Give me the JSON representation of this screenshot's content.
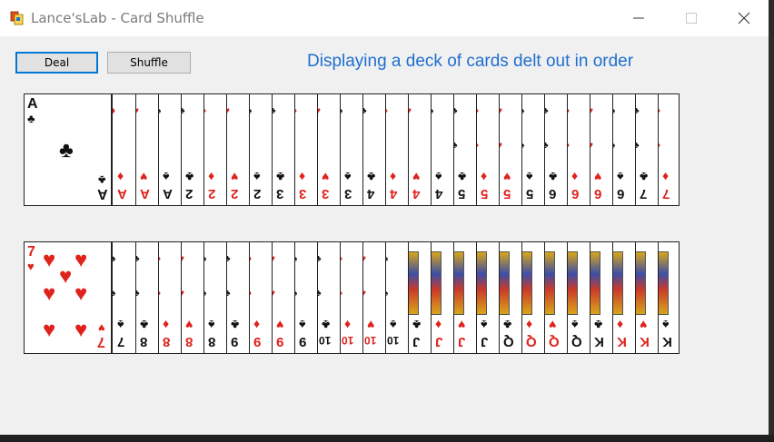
{
  "window": {
    "title": "Lance'sLab - Card Shuffle",
    "icons": {
      "app": "cards-app-icon",
      "minimize": "minimize-icon",
      "maximize": "maximize-icon",
      "close": "close-icon"
    }
  },
  "toolbar": {
    "deal_label": "Deal",
    "shuffle_label": "Shuffle"
  },
  "status_text": "Displaying a deck of cards delt out in order",
  "colors": {
    "red_suit": "#e0221c",
    "black_suit": "#111111",
    "accent": "#0078d7",
    "status_text": "#1f6fd0"
  },
  "rows": [
    {
      "cards": [
        {
          "rank": "A",
          "suit": "♣",
          "color": "black"
        },
        {
          "rank": "A",
          "suit": "♦",
          "color": "red"
        },
        {
          "rank": "A",
          "suit": "♥",
          "color": "red"
        },
        {
          "rank": "A",
          "suit": "♠",
          "color": "black"
        },
        {
          "rank": "2",
          "suit": "♣",
          "color": "black"
        },
        {
          "rank": "2",
          "suit": "♦",
          "color": "red"
        },
        {
          "rank": "2",
          "suit": "♥",
          "color": "red"
        },
        {
          "rank": "2",
          "suit": "♠",
          "color": "black"
        },
        {
          "rank": "3",
          "suit": "♣",
          "color": "black"
        },
        {
          "rank": "3",
          "suit": "♦",
          "color": "red"
        },
        {
          "rank": "3",
          "suit": "♥",
          "color": "red"
        },
        {
          "rank": "3",
          "suit": "♠",
          "color": "black"
        },
        {
          "rank": "4",
          "suit": "♣",
          "color": "black"
        },
        {
          "rank": "4",
          "suit": "♦",
          "color": "red"
        },
        {
          "rank": "4",
          "suit": "♥",
          "color": "red"
        },
        {
          "rank": "4",
          "suit": "♠",
          "color": "black"
        },
        {
          "rank": "5",
          "suit": "♣",
          "color": "black"
        },
        {
          "rank": "5",
          "suit": "♦",
          "color": "red"
        },
        {
          "rank": "5",
          "suit": "♥",
          "color": "red"
        },
        {
          "rank": "5",
          "suit": "♠",
          "color": "black"
        },
        {
          "rank": "6",
          "suit": "♣",
          "color": "black"
        },
        {
          "rank": "6",
          "suit": "♦",
          "color": "red"
        },
        {
          "rank": "6",
          "suit": "♥",
          "color": "red"
        },
        {
          "rank": "6",
          "suit": "♠",
          "color": "black"
        },
        {
          "rank": "7",
          "suit": "♣",
          "color": "black"
        },
        {
          "rank": "7",
          "suit": "♦",
          "color": "red"
        }
      ]
    },
    {
      "cards": [
        {
          "rank": "7",
          "suit": "♥",
          "color": "red"
        },
        {
          "rank": "7",
          "suit": "♠",
          "color": "black"
        },
        {
          "rank": "8",
          "suit": "♣",
          "color": "black"
        },
        {
          "rank": "8",
          "suit": "♦",
          "color": "red"
        },
        {
          "rank": "8",
          "suit": "♥",
          "color": "red"
        },
        {
          "rank": "8",
          "suit": "♠",
          "color": "black"
        },
        {
          "rank": "9",
          "suit": "♣",
          "color": "black"
        },
        {
          "rank": "9",
          "suit": "♦",
          "color": "red"
        },
        {
          "rank": "9",
          "suit": "♥",
          "color": "red"
        },
        {
          "rank": "9",
          "suit": "♠",
          "color": "black"
        },
        {
          "rank": "10",
          "suit": "♣",
          "color": "black"
        },
        {
          "rank": "10",
          "suit": "♦",
          "color": "red"
        },
        {
          "rank": "10",
          "suit": "♥",
          "color": "red"
        },
        {
          "rank": "10",
          "suit": "♠",
          "color": "black"
        },
        {
          "rank": "J",
          "suit": "♣",
          "color": "black"
        },
        {
          "rank": "J",
          "suit": "♦",
          "color": "red"
        },
        {
          "rank": "J",
          "suit": "♥",
          "color": "red"
        },
        {
          "rank": "J",
          "suit": "♠",
          "color": "black"
        },
        {
          "rank": "Q",
          "suit": "♣",
          "color": "black"
        },
        {
          "rank": "Q",
          "suit": "♦",
          "color": "red"
        },
        {
          "rank": "Q",
          "suit": "♥",
          "color": "red"
        },
        {
          "rank": "Q",
          "suit": "♠",
          "color": "black"
        },
        {
          "rank": "K",
          "suit": "♣",
          "color": "black"
        },
        {
          "rank": "K",
          "suit": "♦",
          "color": "red"
        },
        {
          "rank": "K",
          "suit": "♥",
          "color": "red"
        },
        {
          "rank": "K",
          "suit": "♠",
          "color": "black"
        }
      ]
    }
  ]
}
